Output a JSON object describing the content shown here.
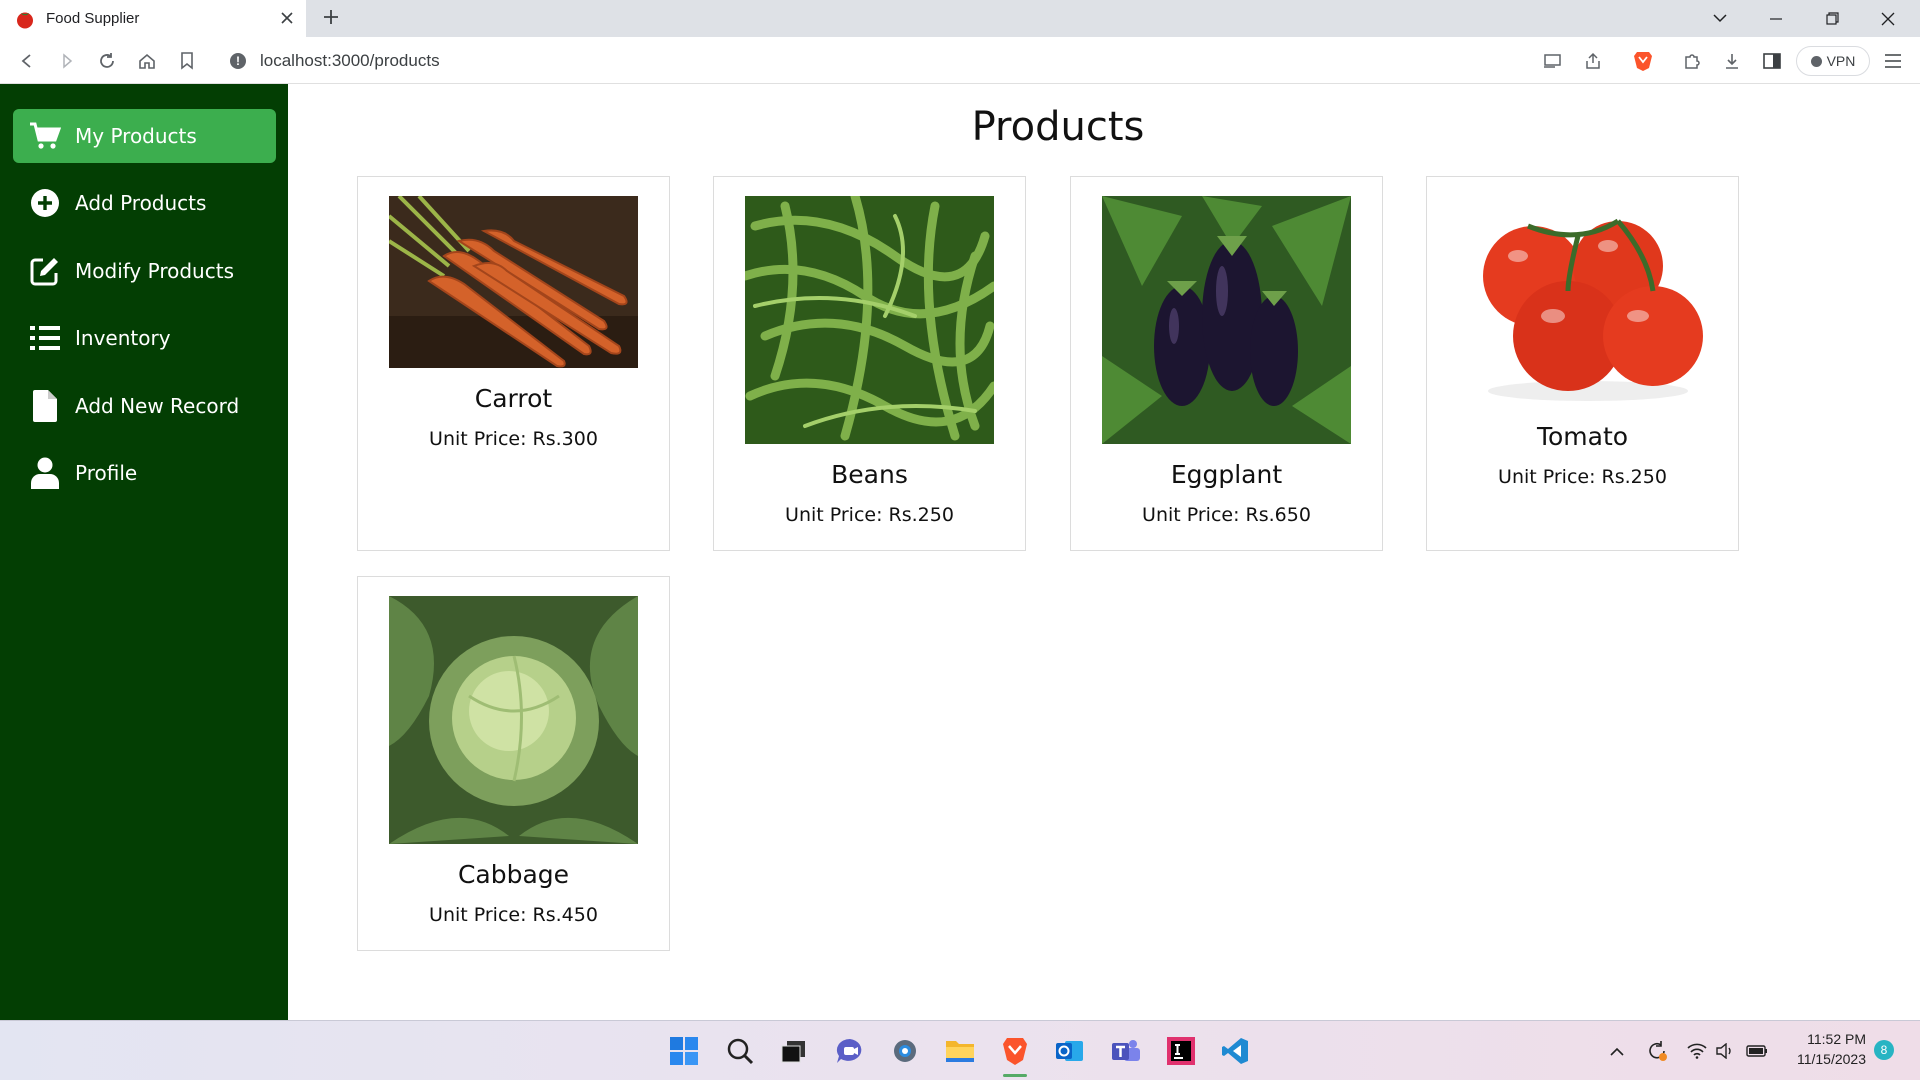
{
  "browser": {
    "tab_title": "Food Supplier",
    "url": "localhost:3000/products",
    "vpn_label": "VPN"
  },
  "sidebar": {
    "items": [
      {
        "label": "My Products",
        "icon": "cart-icon",
        "active": true
      },
      {
        "label": "Add Products",
        "icon": "plus-circle-icon",
        "active": false
      },
      {
        "label": "Modify Products",
        "icon": "edit-icon",
        "active": false
      },
      {
        "label": "Inventory",
        "icon": "list-icon",
        "active": false
      },
      {
        "label": "Add New Record",
        "icon": "file-icon",
        "active": false
      },
      {
        "label": "Profile",
        "icon": "user-icon",
        "active": false
      }
    ]
  },
  "main": {
    "title": "Products",
    "products": [
      {
        "name": "Carrot",
        "price": "Unit Price: Rs.300",
        "image": "carrot-image"
      },
      {
        "name": "Beans",
        "price": "Unit Price: Rs.250",
        "image": "beans-image"
      },
      {
        "name": "Eggplant",
        "price": "Unit Price: Rs.650",
        "image": "eggplant-image"
      },
      {
        "name": "Tomato",
        "price": "Unit Price: Rs.250",
        "image": "tomato-image"
      },
      {
        "name": "Cabbage",
        "price": "Unit Price: Rs.450",
        "image": "cabbage-image"
      }
    ]
  },
  "taskbar": {
    "time": "11:52 PM",
    "date": "11/15/2023",
    "notification_count": "8"
  },
  "colors": {
    "sidebar_bg": "#033e03",
    "active_item": "#3cae4e"
  }
}
